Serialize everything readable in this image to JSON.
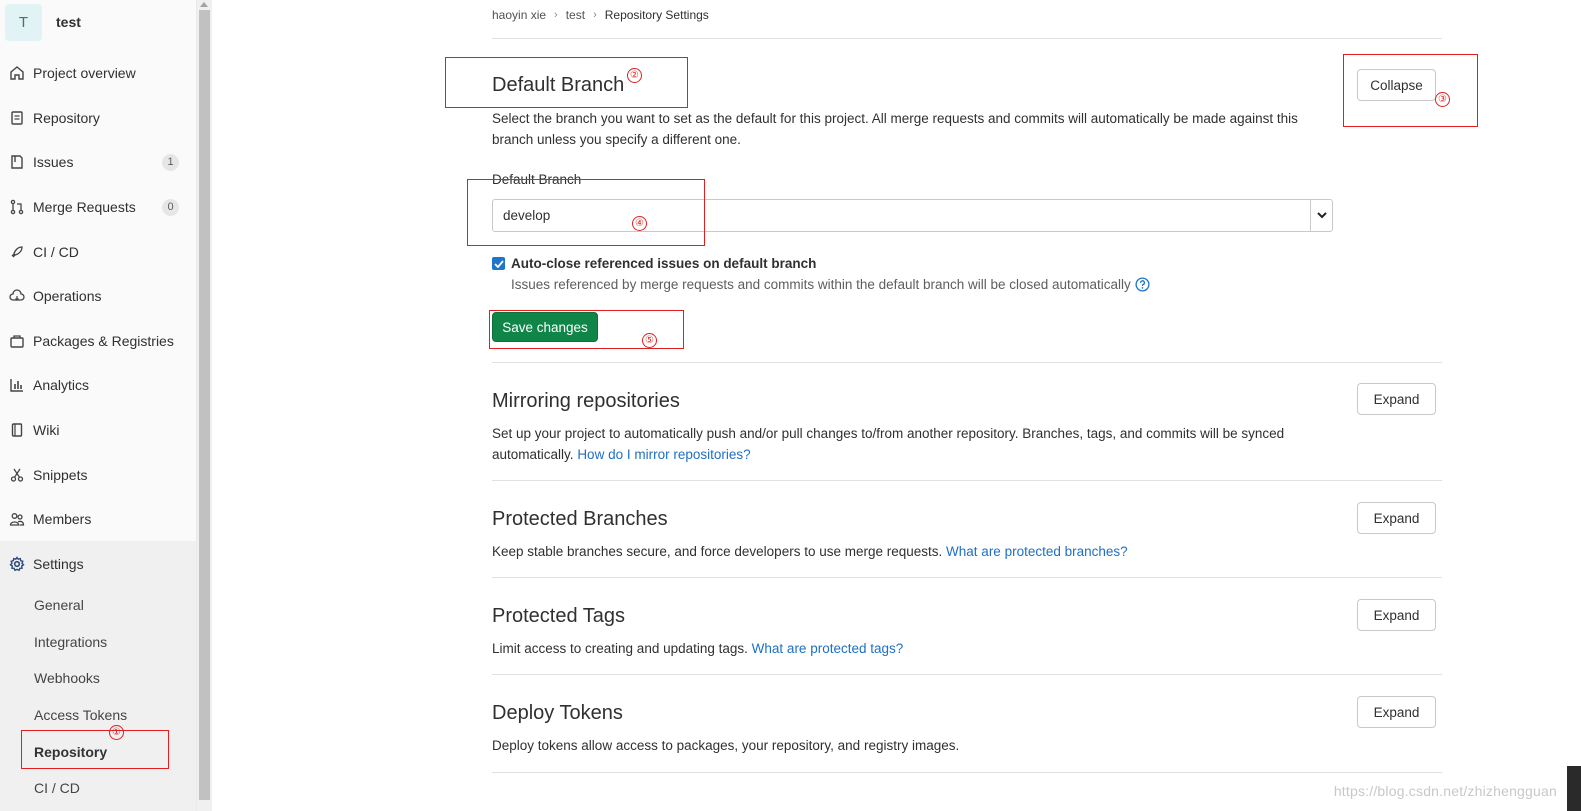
{
  "project": {
    "avatar_letter": "T",
    "name": "test"
  },
  "sidebar": {
    "items": [
      {
        "label": "Project overview",
        "icon": "home-icon"
      },
      {
        "label": "Repository",
        "icon": "document-icon"
      },
      {
        "label": "Issues",
        "icon": "issues-icon",
        "count": "1"
      },
      {
        "label": "Merge Requests",
        "icon": "merge-request-icon",
        "count": "0"
      },
      {
        "label": "CI / CD",
        "icon": "rocket-icon"
      },
      {
        "label": "Operations",
        "icon": "cloud-icon"
      },
      {
        "label": "Packages & Registries",
        "icon": "package-icon"
      },
      {
        "label": "Analytics",
        "icon": "chart-icon"
      },
      {
        "label": "Wiki",
        "icon": "book-icon"
      },
      {
        "label": "Snippets",
        "icon": "scissors-icon"
      },
      {
        "label": "Members",
        "icon": "users-icon"
      },
      {
        "label": "Settings",
        "icon": "gear-icon"
      }
    ],
    "settings_sub": [
      "General",
      "Integrations",
      "Webhooks",
      "Access Tokens",
      "Repository",
      "CI / CD"
    ]
  },
  "breadcrumb": [
    "haoyin xie",
    "test",
    "Repository Settings"
  ],
  "default_branch": {
    "title": "Default Branch",
    "description": "Select the branch you want to set as the default for this project. All merge requests and commits will automatically be made against this branch unless you specify a different one.",
    "collapse_label": "Collapse",
    "field_label": "Default Branch",
    "selected": "develop",
    "checkbox_label": "Auto-close referenced issues on default branch",
    "checkbox_checked": true,
    "checkbox_help": "Issues referenced by merge requests and commits within the default branch will be closed automatically",
    "save_label": "Save changes"
  },
  "sections": [
    {
      "title": "Mirroring repositories",
      "description": "Set up your project to automatically push and/or pull changes to/from another repository. Branches, tags, and commits will be synced automatically.",
      "link": "How do I mirror repositories?",
      "button": "Expand"
    },
    {
      "title": "Protected Branches",
      "description": "Keep stable branches secure, and force developers to use merge requests.",
      "link": "What are protected branches?",
      "button": "Expand"
    },
    {
      "title": "Protected Tags",
      "description": "Limit access to creating and updating tags.",
      "link": "What are protected tags?",
      "button": "Expand"
    },
    {
      "title": "Deploy Tokens",
      "description": "Deploy tokens allow access to packages, your repository, and registry images.",
      "button": "Expand"
    }
  ],
  "annotations": [
    "①",
    "②",
    "③",
    "④",
    "⑤"
  ],
  "watermark": "https://blog.csdn.net/zhizhengguan",
  "colors": {
    "primary_green": "#108548",
    "link_blue": "#1f6fc5",
    "annotation_red": "#e02020"
  }
}
